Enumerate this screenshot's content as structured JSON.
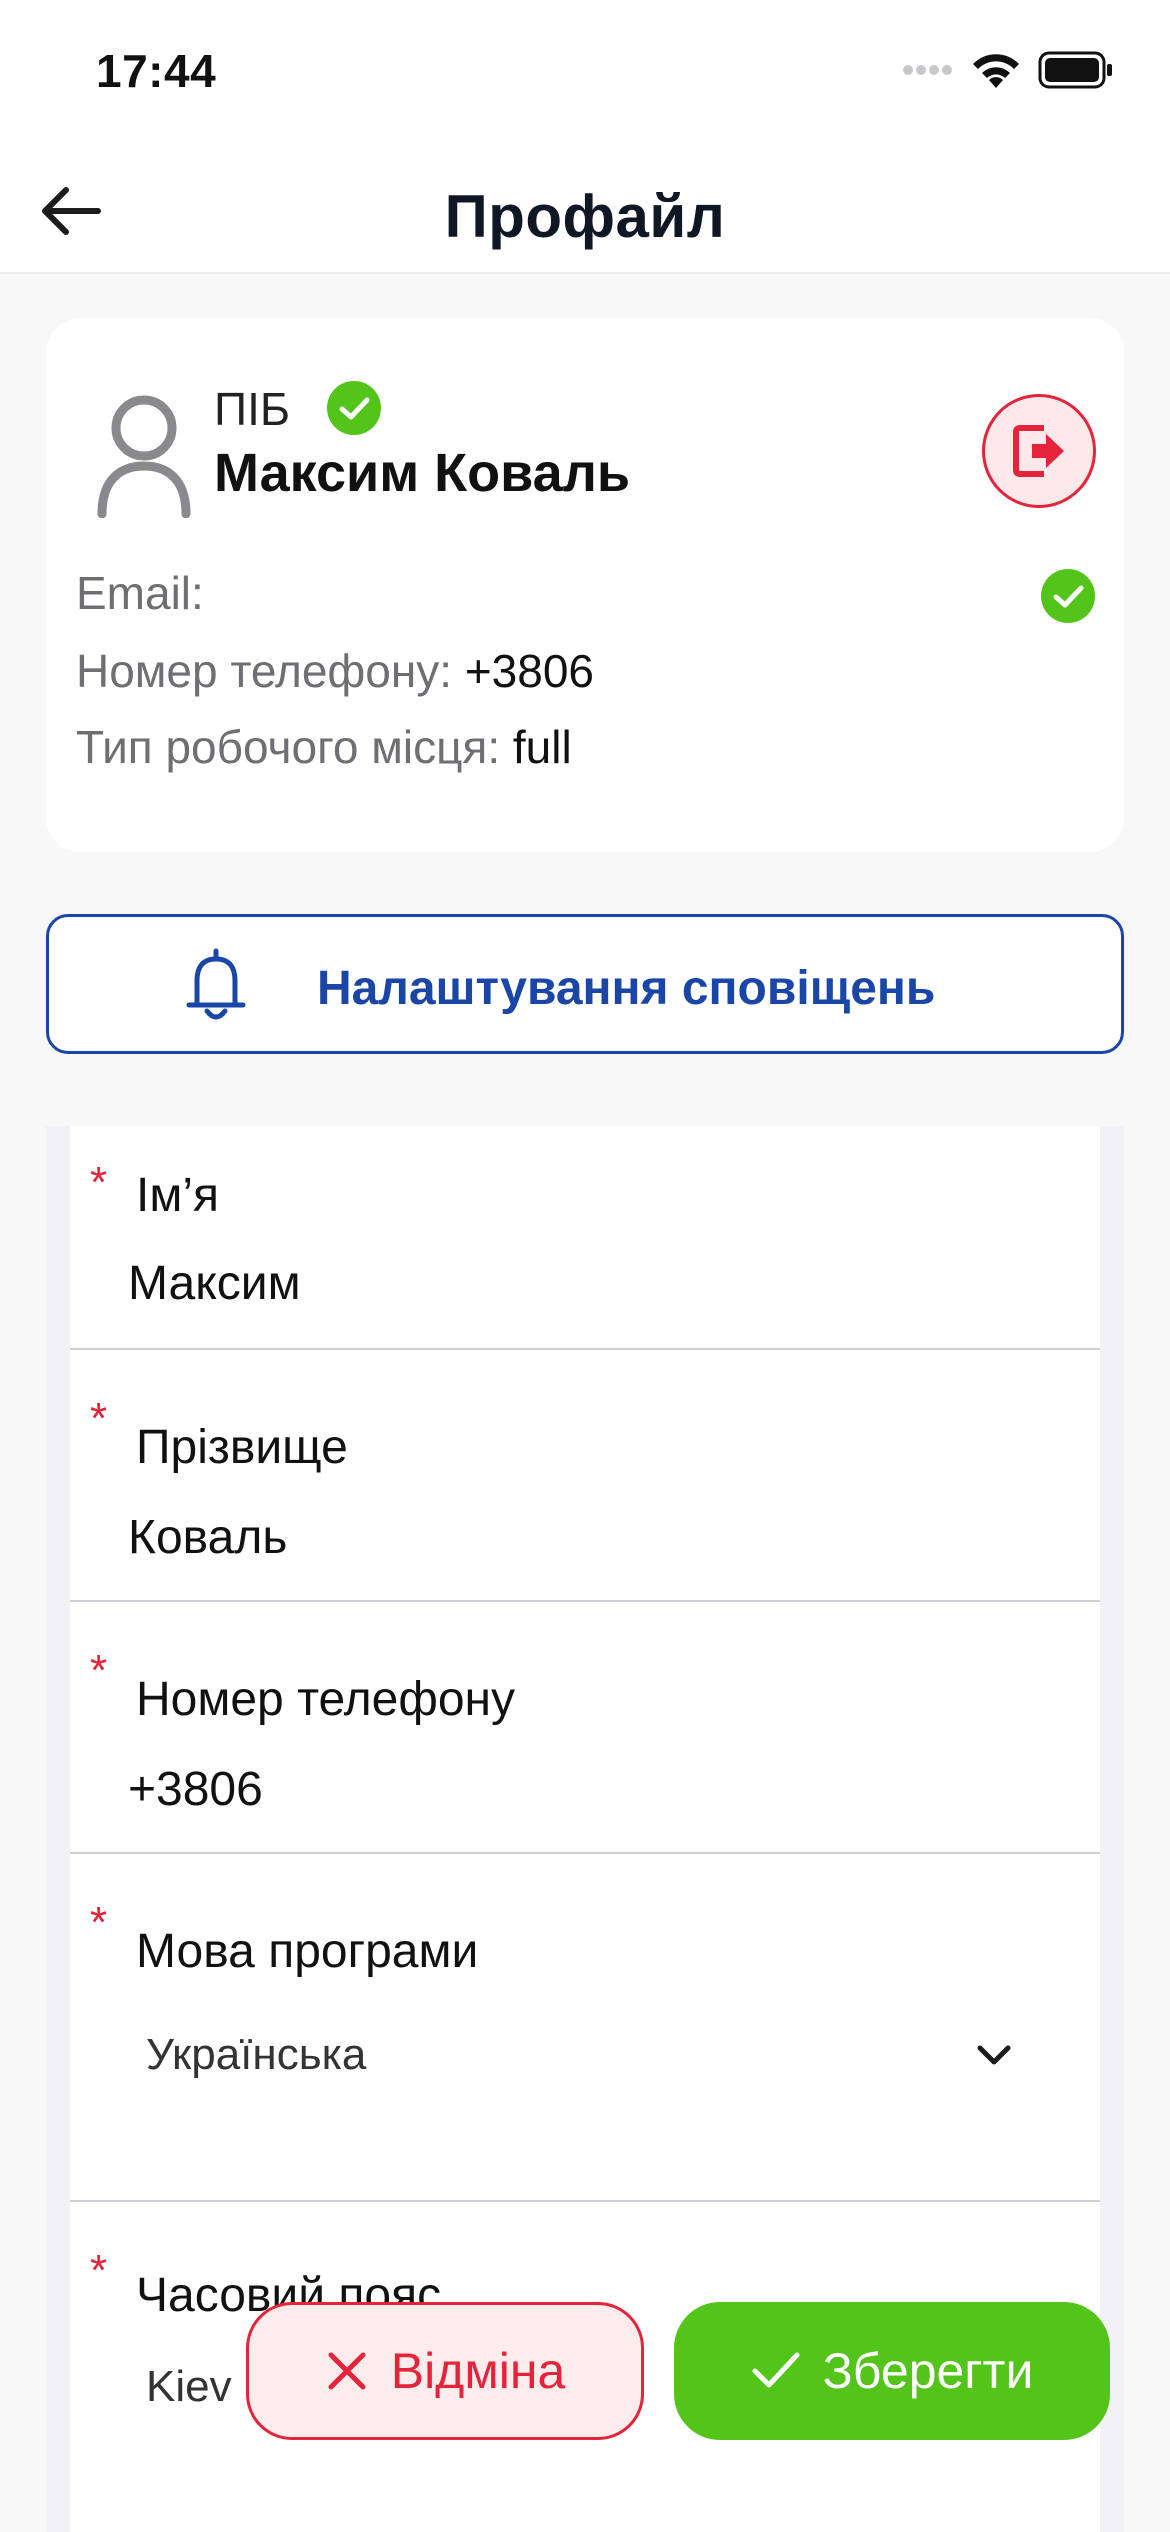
{
  "status": {
    "time": "17:44"
  },
  "header": {
    "title": "Профайл"
  },
  "profile": {
    "pib_label": "ПІБ",
    "full_name": "Максим Коваль",
    "email_label": "Email:",
    "email_value": "",
    "phone_label": "Номер телефону:",
    "phone_value": "+3806",
    "work_label": "Тип робочого місця:",
    "work_value": "full"
  },
  "notifications": {
    "label": "Налаштування сповіщень"
  },
  "form": {
    "first_name": {
      "label": "Ім’я",
      "value": "Максим",
      "required": "*"
    },
    "last_name": {
      "label": "Прізвище",
      "value": "Коваль",
      "required": "*"
    },
    "phone": {
      "label": "Номер телефону",
      "value": "+3806",
      "required": "*"
    },
    "language": {
      "label": "Мова програми",
      "value": "Українська",
      "required": "*"
    },
    "timezone": {
      "label": "Часовий пояс",
      "value": "Kiev (",
      "required": "*"
    }
  },
  "actions": {
    "cancel": "Відміна",
    "save": "Зберегти"
  },
  "colors": {
    "accent_blue": "#1a46a8",
    "danger": "#e5243b",
    "success": "#52c41a"
  }
}
